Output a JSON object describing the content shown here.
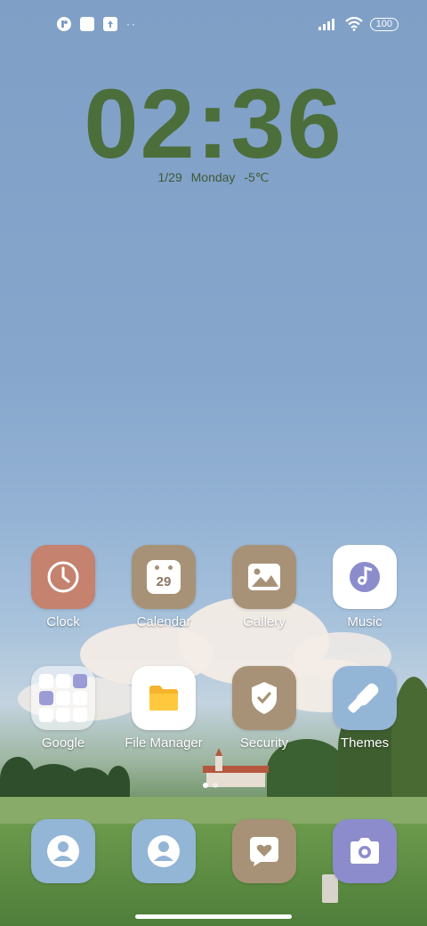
{
  "status_bar": {
    "overflow_dots": "··",
    "battery": "100",
    "icons": [
      "app-notification-icon",
      "square-notification-icon",
      "upload-notification-icon",
      "signal-icon",
      "wifi-icon",
      "battery-icon"
    ]
  },
  "clock_widget": {
    "time": "02:36",
    "date": "1/29",
    "weekday": "Monday",
    "temperature": "-5℃"
  },
  "apps_row1": [
    {
      "label": "Clock",
      "icon": "clock-icon",
      "color": "#c4826f"
    },
    {
      "label": "Calendar",
      "icon": "calendar-icon",
      "day": "29",
      "color": "#a89277"
    },
    {
      "label": "Gallery",
      "icon": "gallery-icon",
      "color": "#a89277"
    },
    {
      "label": "Music",
      "icon": "music-icon",
      "color": "#ffffff"
    }
  ],
  "apps_row2": [
    {
      "label": "Google",
      "icon": "folder-icon"
    },
    {
      "label": "File Manager",
      "icon": "file-manager-icon",
      "color": "#ffffff"
    },
    {
      "label": "Security",
      "icon": "shield-icon",
      "color": "#a89277"
    },
    {
      "label": "Themes",
      "icon": "themes-icon",
      "color": "#93b5d6"
    }
  ],
  "dock": [
    {
      "icon": "contacts-icon",
      "color": "#93b5d6"
    },
    {
      "icon": "contacts-icon",
      "color": "#93b5d6"
    },
    {
      "icon": "messages-icon",
      "color": "#a89277"
    },
    {
      "icon": "camera-icon",
      "color": "#8c8ccc"
    }
  ],
  "page_indicator": {
    "pages": 2,
    "current": 1
  }
}
